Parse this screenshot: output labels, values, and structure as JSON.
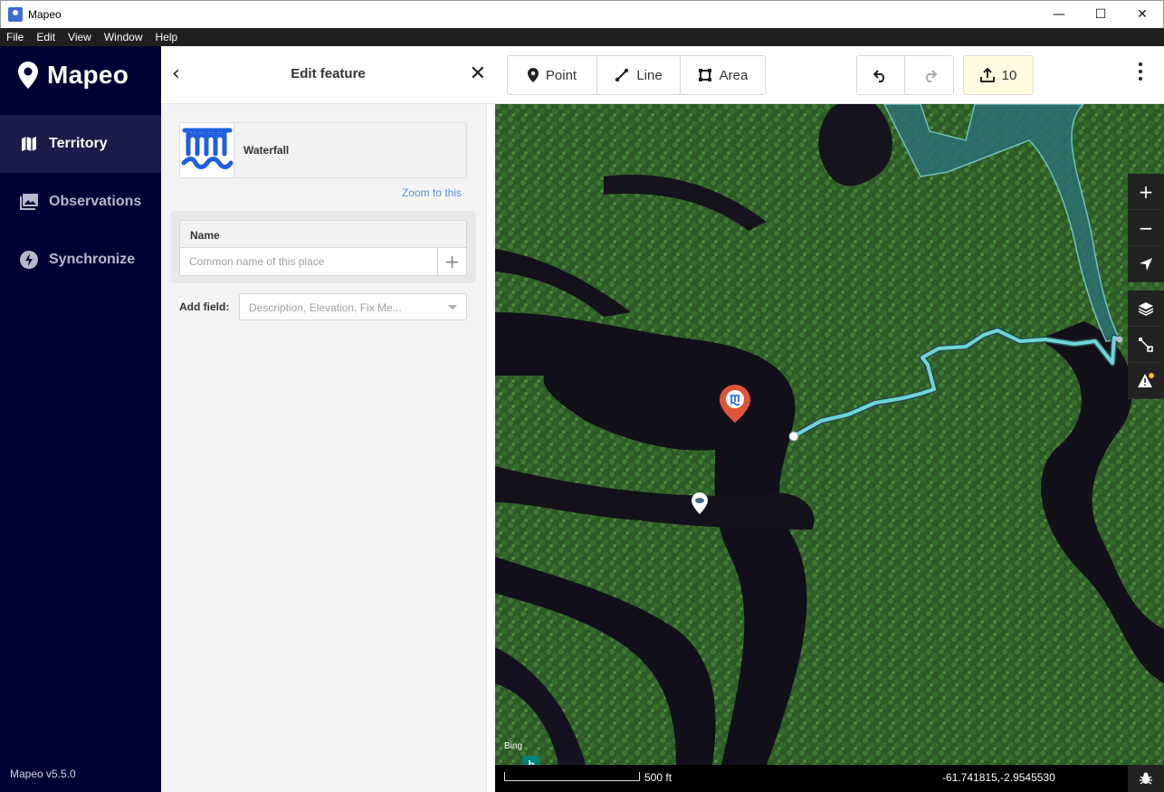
{
  "window": {
    "title": "Mapeo",
    "controls": [
      "—",
      "☐",
      "✕"
    ]
  },
  "menu": [
    "File",
    "Edit",
    "View",
    "Window",
    "Help"
  ],
  "sidebar": {
    "app_name": "Mapeo",
    "items": [
      {
        "label": "Territory",
        "icon": "map-icon",
        "active": true
      },
      {
        "label": "Observations",
        "icon": "photo-icon",
        "active": false
      },
      {
        "label": "Synchronize",
        "icon": "lightning-icon",
        "active": false
      }
    ],
    "version": "Mapeo v5.5.0"
  },
  "panel": {
    "title": "Edit feature",
    "preset": {
      "name": "Waterfall",
      "icon": "waterfall-icon"
    },
    "zoom_link": "Zoom to this",
    "name_field": {
      "label": "Name",
      "placeholder": "Common name of this place"
    },
    "add_field": {
      "label": "Add field:",
      "placeholder": "Description, Elevation, Fix Me..."
    }
  },
  "toolbar": {
    "point": "Point",
    "line": "Line",
    "area": "Area",
    "upload_count": "10"
  },
  "map": {
    "attribution": "Bing",
    "scale_label": "500 ft",
    "coordinates": "-61.741815,-2.9545530",
    "line_color": "#6ed6d6",
    "marker_color": "#e0543c"
  }
}
